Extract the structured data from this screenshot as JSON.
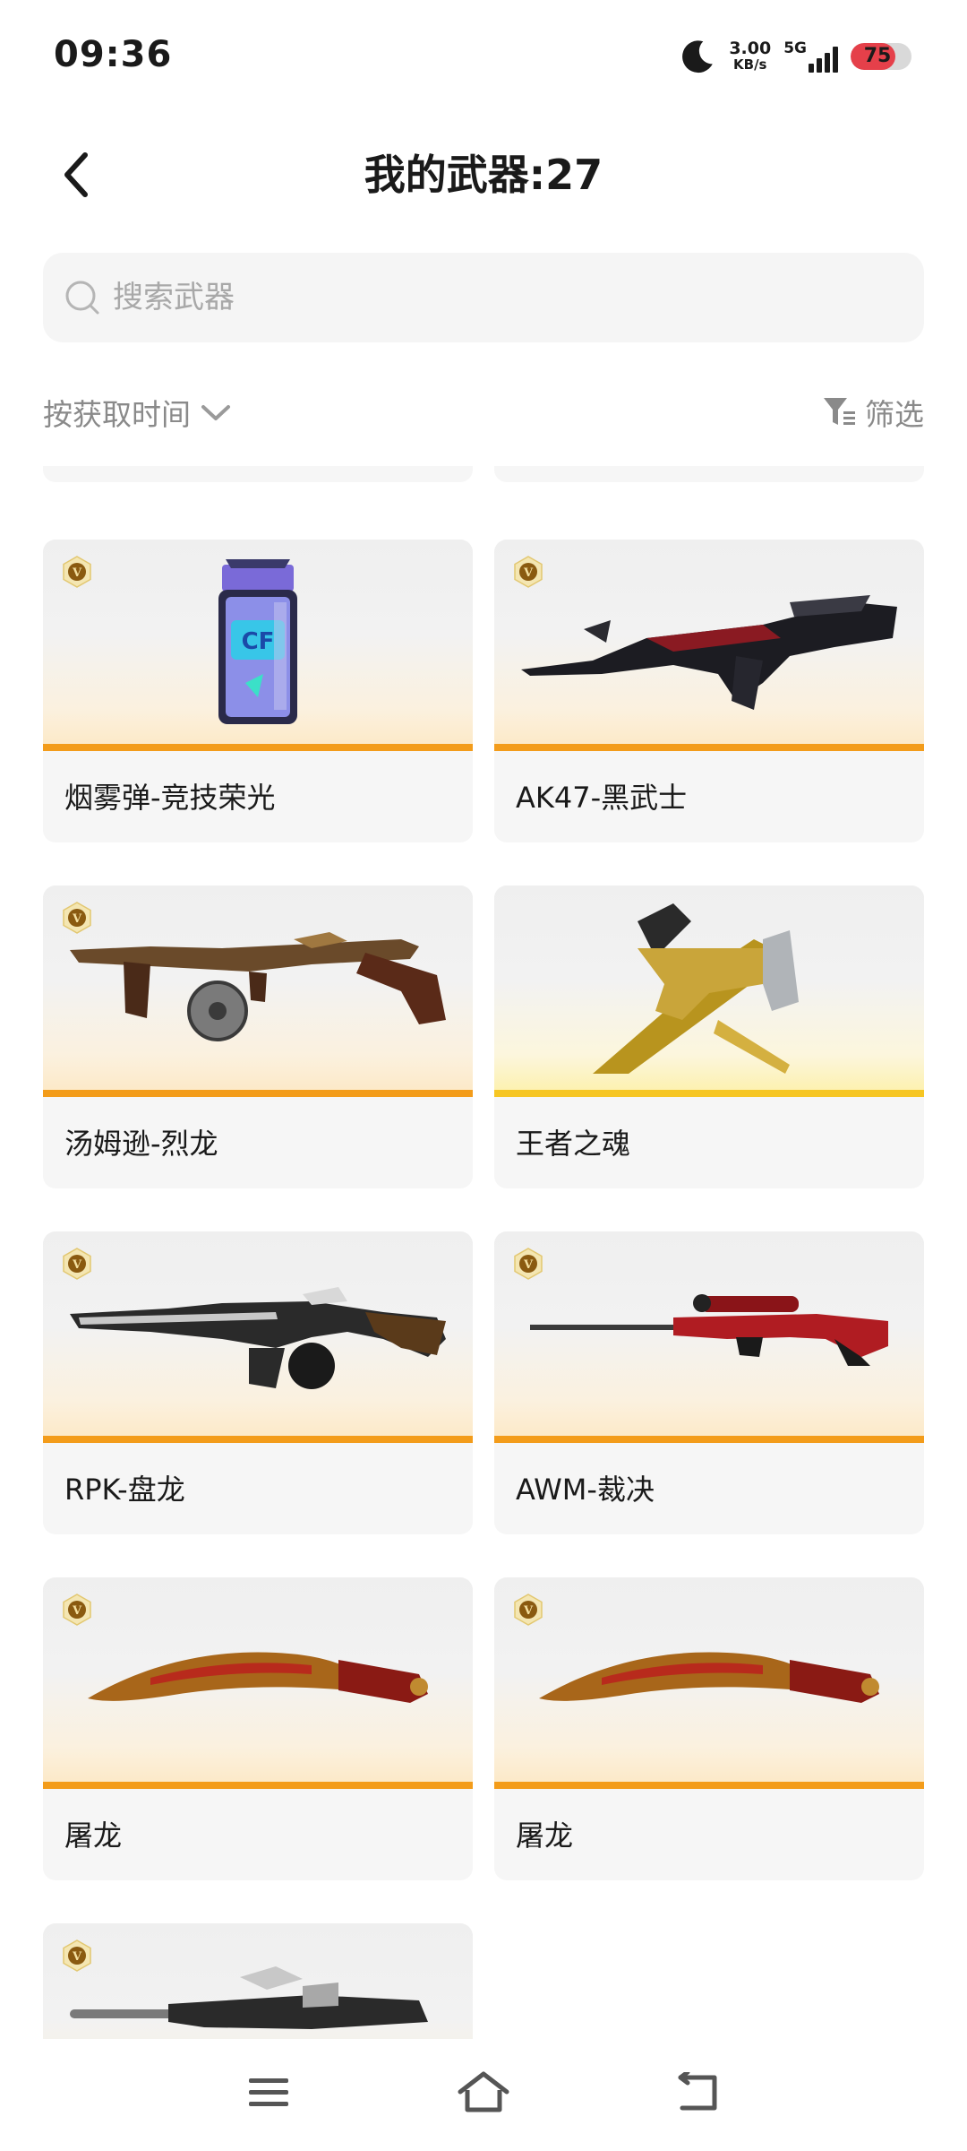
{
  "status_bar": {
    "time": "09:36",
    "speed_value": "3.00",
    "speed_unit": "KB/s",
    "network_type": "5G",
    "battery": "75",
    "battery_color": "#e5404a"
  },
  "header": {
    "title": "我的武器:27",
    "back_icon": "chevron-left-icon"
  },
  "search": {
    "placeholder": "搜索武器",
    "value": ""
  },
  "toolbar": {
    "sort_label": "按获取时间",
    "filter_label": "筛选"
  },
  "weapons": [
    {
      "name": "烟雾弹-竞技荣光",
      "badge": "V",
      "rarity_color": "#f39c1a"
    },
    {
      "name": "AK47-黑武士",
      "badge": "V",
      "rarity_color": "#f39c1a"
    },
    {
      "name": "汤姆逊-烈龙",
      "badge": "V",
      "rarity_color": "#f39c1a"
    },
    {
      "name": "王者之魂",
      "badge": "",
      "rarity_color": "#f6c623"
    },
    {
      "name": "RPK-盘龙",
      "badge": "V",
      "rarity_color": "#f39c1a"
    },
    {
      "name": "AWM-裁决",
      "badge": "V",
      "rarity_color": "#f39c1a"
    },
    {
      "name": "屠龙",
      "badge": "V",
      "rarity_color": "#f39c1a"
    },
    {
      "name": "屠龙",
      "badge": "V",
      "rarity_color": "#f39c1a"
    },
    {
      "name": "",
      "badge": "V",
      "rarity_color": "#f39c1a"
    }
  ],
  "nav": {
    "menu_icon": "menu-icon",
    "home_icon": "home-icon",
    "back_icon": "back-arrow-icon"
  }
}
